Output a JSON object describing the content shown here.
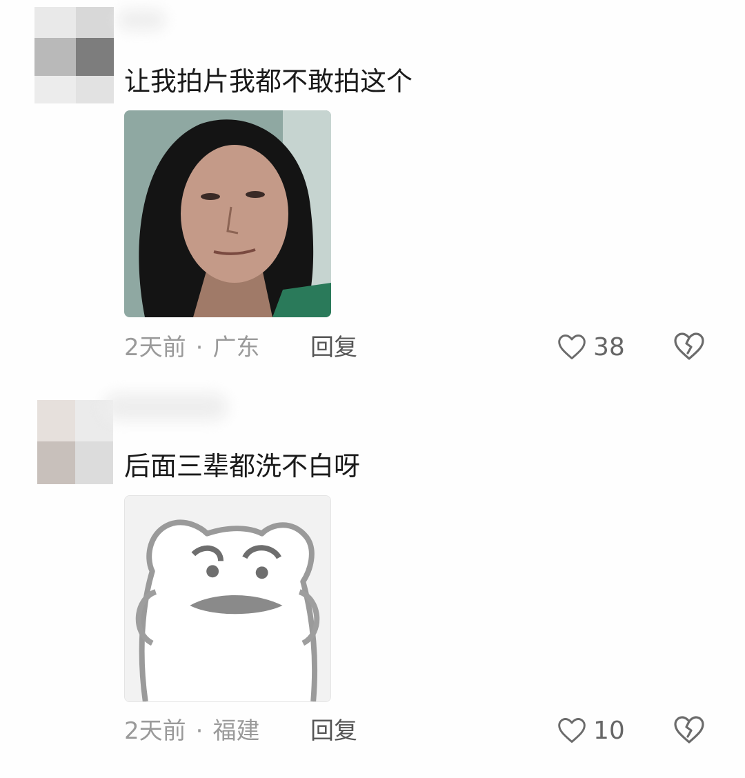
{
  "comments": [
    {
      "text": "让我拍片我都不敢拍这个",
      "time": "2天前",
      "separator": "·",
      "location": "广东",
      "reply_label": "回复",
      "like_count": "38",
      "image_icon": "photo-woman-portrait"
    },
    {
      "text": "后面三辈都洗不白呀",
      "time": "2天前",
      "separator": "·",
      "location": "福建",
      "reply_label": "回复",
      "like_count": "10",
      "image_icon": "sketch-frog-meme-sticker"
    }
  ],
  "icons": {
    "like": "heart-outline-icon",
    "dislike": "broken-heart-icon"
  },
  "colors": {
    "background": "#fefefe",
    "comment_text": "#1a1a1a",
    "meta_text": "#9a9a9a",
    "reply_text": "#555555",
    "icon_stroke": "#6b6b6b"
  }
}
